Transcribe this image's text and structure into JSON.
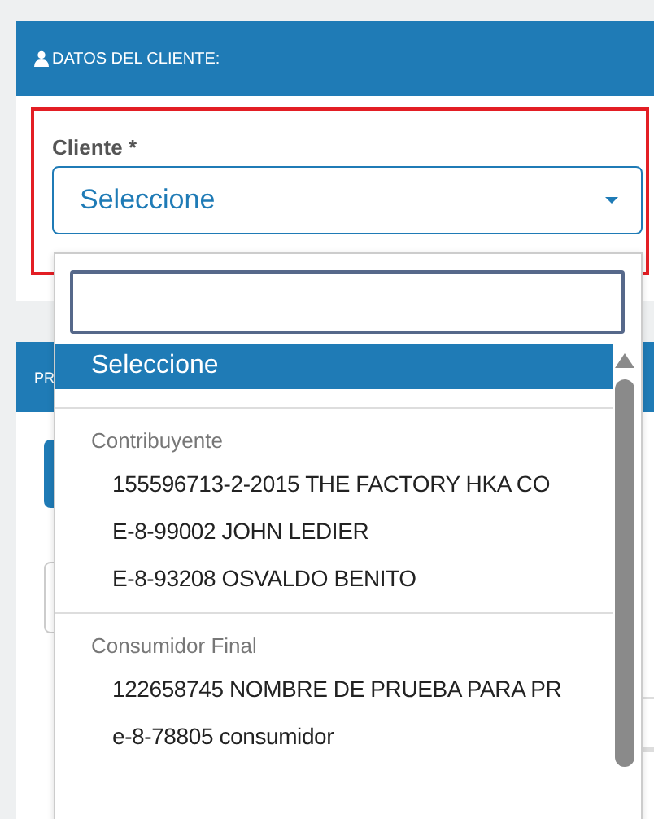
{
  "section": {
    "title": "DATOS DEL CLIENTE:"
  },
  "field": {
    "label": "Cliente *",
    "value": "Seleccione"
  },
  "dropdown": {
    "options": [
      {
        "label": "Seleccione",
        "selected": true
      }
    ],
    "groups": [
      {
        "label": "Contribuyente",
        "options": [
          {
            "label": "155596713-2-2015 THE FACTORY HKA CO",
            "selected": false
          },
          {
            "label": "E-8-99002 JOHN LEDIER",
            "selected": false
          },
          {
            "label": "E-8-93208 OSVALDO BENITO",
            "selected": false
          }
        ]
      },
      {
        "label": "Consumidor Final",
        "options": [
          {
            "label": "122658745 NOMBRE DE PRUEBA PARA PR",
            "selected": false
          },
          {
            "label": "e-8-78805 consumidor",
            "selected": false
          }
        ]
      }
    ]
  },
  "background": {
    "section_title": "PR"
  }
}
